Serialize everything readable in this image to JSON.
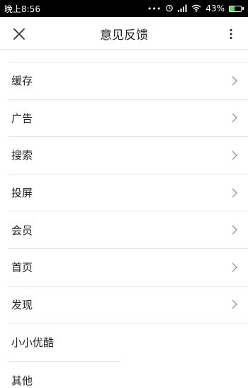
{
  "statusbar": {
    "time": "晚上8:56",
    "battery_percent": "43%",
    "battery_level": 0.43,
    "icons": [
      "more-dots-icon",
      "alarm-icon",
      "signal-icon",
      "wifi-icon",
      "battery-icon"
    ]
  },
  "header": {
    "title": "意见反馈",
    "left_icon": "close-icon",
    "right_icon": "more-vertical-icon"
  },
  "list": {
    "items": [
      {
        "label": "缓存",
        "arrow": true
      },
      {
        "label": "广告",
        "arrow": true
      },
      {
        "label": "搜索",
        "arrow": true
      },
      {
        "label": "投屏",
        "arrow": true
      },
      {
        "label": "会员",
        "arrow": true
      },
      {
        "label": "首页",
        "arrow": true
      },
      {
        "label": "发现",
        "arrow": true
      },
      {
        "label": "小小优酷",
        "arrow": false
      },
      {
        "label": "其他",
        "arrow": false
      }
    ]
  },
  "colors": {
    "statusbar_bg": "#000000",
    "divider": "#e6e6e6",
    "text": "#222222",
    "chevron": "#999999"
  }
}
